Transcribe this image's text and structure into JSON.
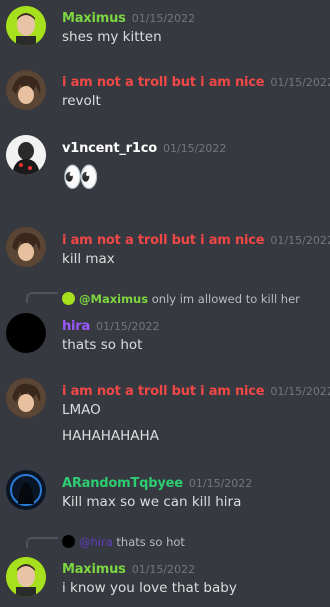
{
  "colors": {
    "background": "#36393f",
    "maximus": "#7cd641",
    "troll": "#f04747",
    "vincent": "#ffffff",
    "hira": "#9b59ff",
    "arandom": "#2ecc71",
    "timestamp": "#72767d",
    "text": "#dcddde"
  },
  "messages": [
    {
      "author": "Maximus",
      "timestamp": "01/15/2022",
      "lines": [
        "shes my kitten"
      ]
    },
    {
      "author": "i am not a troll but i am nice",
      "timestamp": "01/15/2022",
      "lines": [
        "revolt"
      ]
    },
    {
      "author": "v1ncent_r1co",
      "timestamp": "01/15/2022",
      "emoji": "👀"
    },
    {
      "author": "i am not a troll but i am nice",
      "timestamp": "01/15/2022",
      "lines": [
        "kill max"
      ]
    },
    {
      "reply": {
        "mention": "@Maximus",
        "text": "only im allowed to kill her"
      },
      "author": "hira",
      "timestamp": "01/15/2022",
      "lines": [
        "thats so hot"
      ]
    },
    {
      "author": "i am not a troll but i am nice",
      "timestamp": "01/15/2022",
      "lines": [
        "LMAO",
        "HAHAHAHAHA"
      ]
    },
    {
      "author": "ARandomTqbyee",
      "timestamp": "01/15/2022",
      "lines": [
        "Kill max so we can kill hira"
      ]
    },
    {
      "reply": {
        "mention": "@hira",
        "text": "thats so hot"
      },
      "author": "Maximus",
      "timestamp": "01/15/2022",
      "lines": [
        "i know you love that baby"
      ]
    }
  ]
}
